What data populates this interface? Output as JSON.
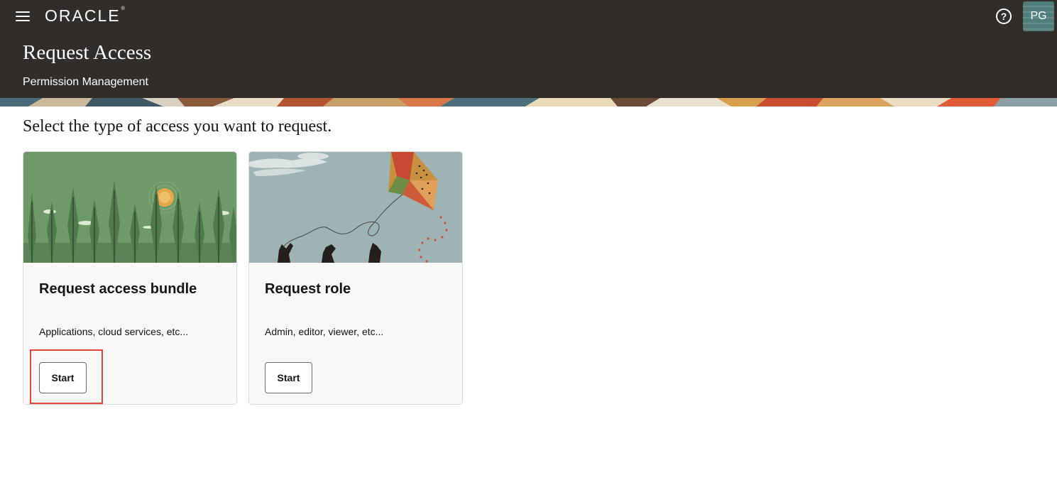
{
  "header": {
    "brand": "ORACLE",
    "brand_mark": "®",
    "title": "Request Access",
    "subtitle": "Permission Management",
    "user_initials": "PG",
    "help_symbol": "?"
  },
  "icons": {
    "menu": "hamburger-menu-icon",
    "help": "help-circle-icon"
  },
  "main": {
    "prompt": "Select the type of access you want to request.",
    "cards": [
      {
        "title": "Request access bundle",
        "description": "Applications, cloud services, etc...",
        "button_label": "Start",
        "illustration": "forest-sun-illustration"
      },
      {
        "title": "Request role",
        "description": "Admin, editor, viewer, etc...",
        "button_label": "Start",
        "illustration": "kite-hands-illustration"
      }
    ]
  },
  "colors": {
    "header_bg": "#312d2a",
    "card_bg": "#f9f8f6",
    "highlight": "#e0453a",
    "forest_bg": "#6e9a6a",
    "sky_bg": "#9db3b5"
  }
}
